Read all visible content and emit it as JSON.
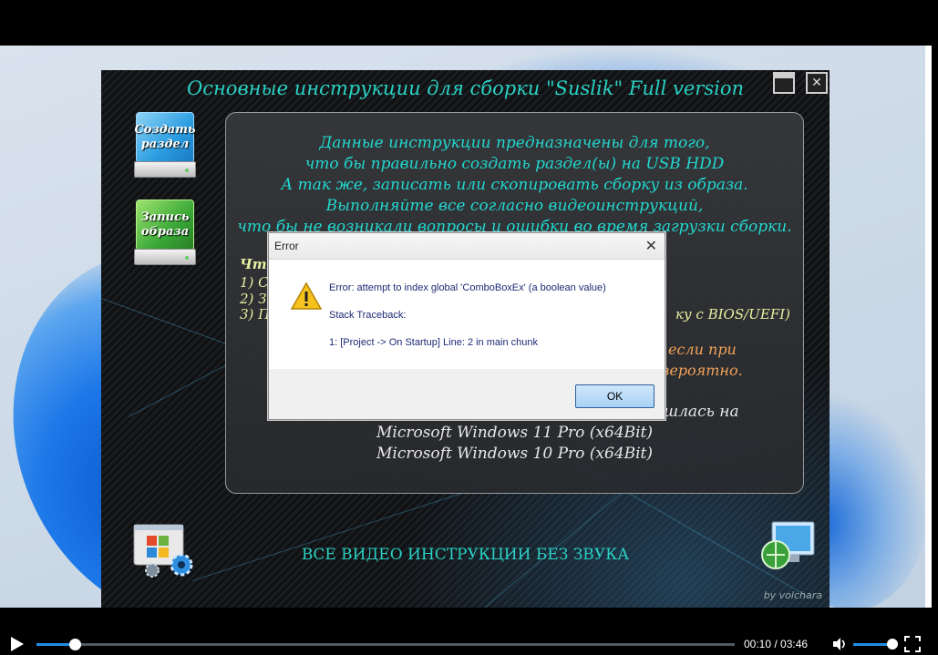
{
  "app": {
    "title": "Основные инструкции для сборки \"Suslik\" Full version",
    "drive_create_label": "Создать раздел",
    "drive_write_label": "Запись образа",
    "intro_lines": [
      "Данные инструкции предназначены для того,",
      "что бы правильно создать раздел(ы) на USB HDD",
      "А так же, записать или скопировать сборку из образа.",
      "Выполняйте все согласно видеоинструкций,",
      "что бы не возникали вопросы и ошибки во время загрузки сборки."
    ],
    "left_lines": [
      "Чт",
      "1) Со",
      "2) За",
      "3) П"
    ],
    "bios_text": "ку с BIOS/UEFI)",
    "right_lines": [
      "если при",
      "вероятно."
    ],
    "tested_partial": "шлась на",
    "tested_lines": [
      "Microsoft Windows 11 Pro (x64Bit)",
      "Microsoft Windows 10 Pro (x64Bit)"
    ],
    "footer": "ВСЕ ВИДЕО ИНСТРУКЦИИ БЕЗ ЗВУКА",
    "credit": "by volchara"
  },
  "dialog": {
    "title": "Error",
    "close_glyph": "✕",
    "line1": "Error: attempt to index global 'ComboBoxEx' (a boolean value)",
    "line2": "Stack Traceback:",
    "line3": "1: [Project -> On Startup] Line: 2 in main chunk",
    "ok_label": "OK"
  },
  "player": {
    "time": "00:10 / 03:46",
    "progress": 0.055,
    "volume": 0.85
  },
  "colors": {
    "accent": "#2ad2c5",
    "player_accent": "#1c8ee8"
  }
}
